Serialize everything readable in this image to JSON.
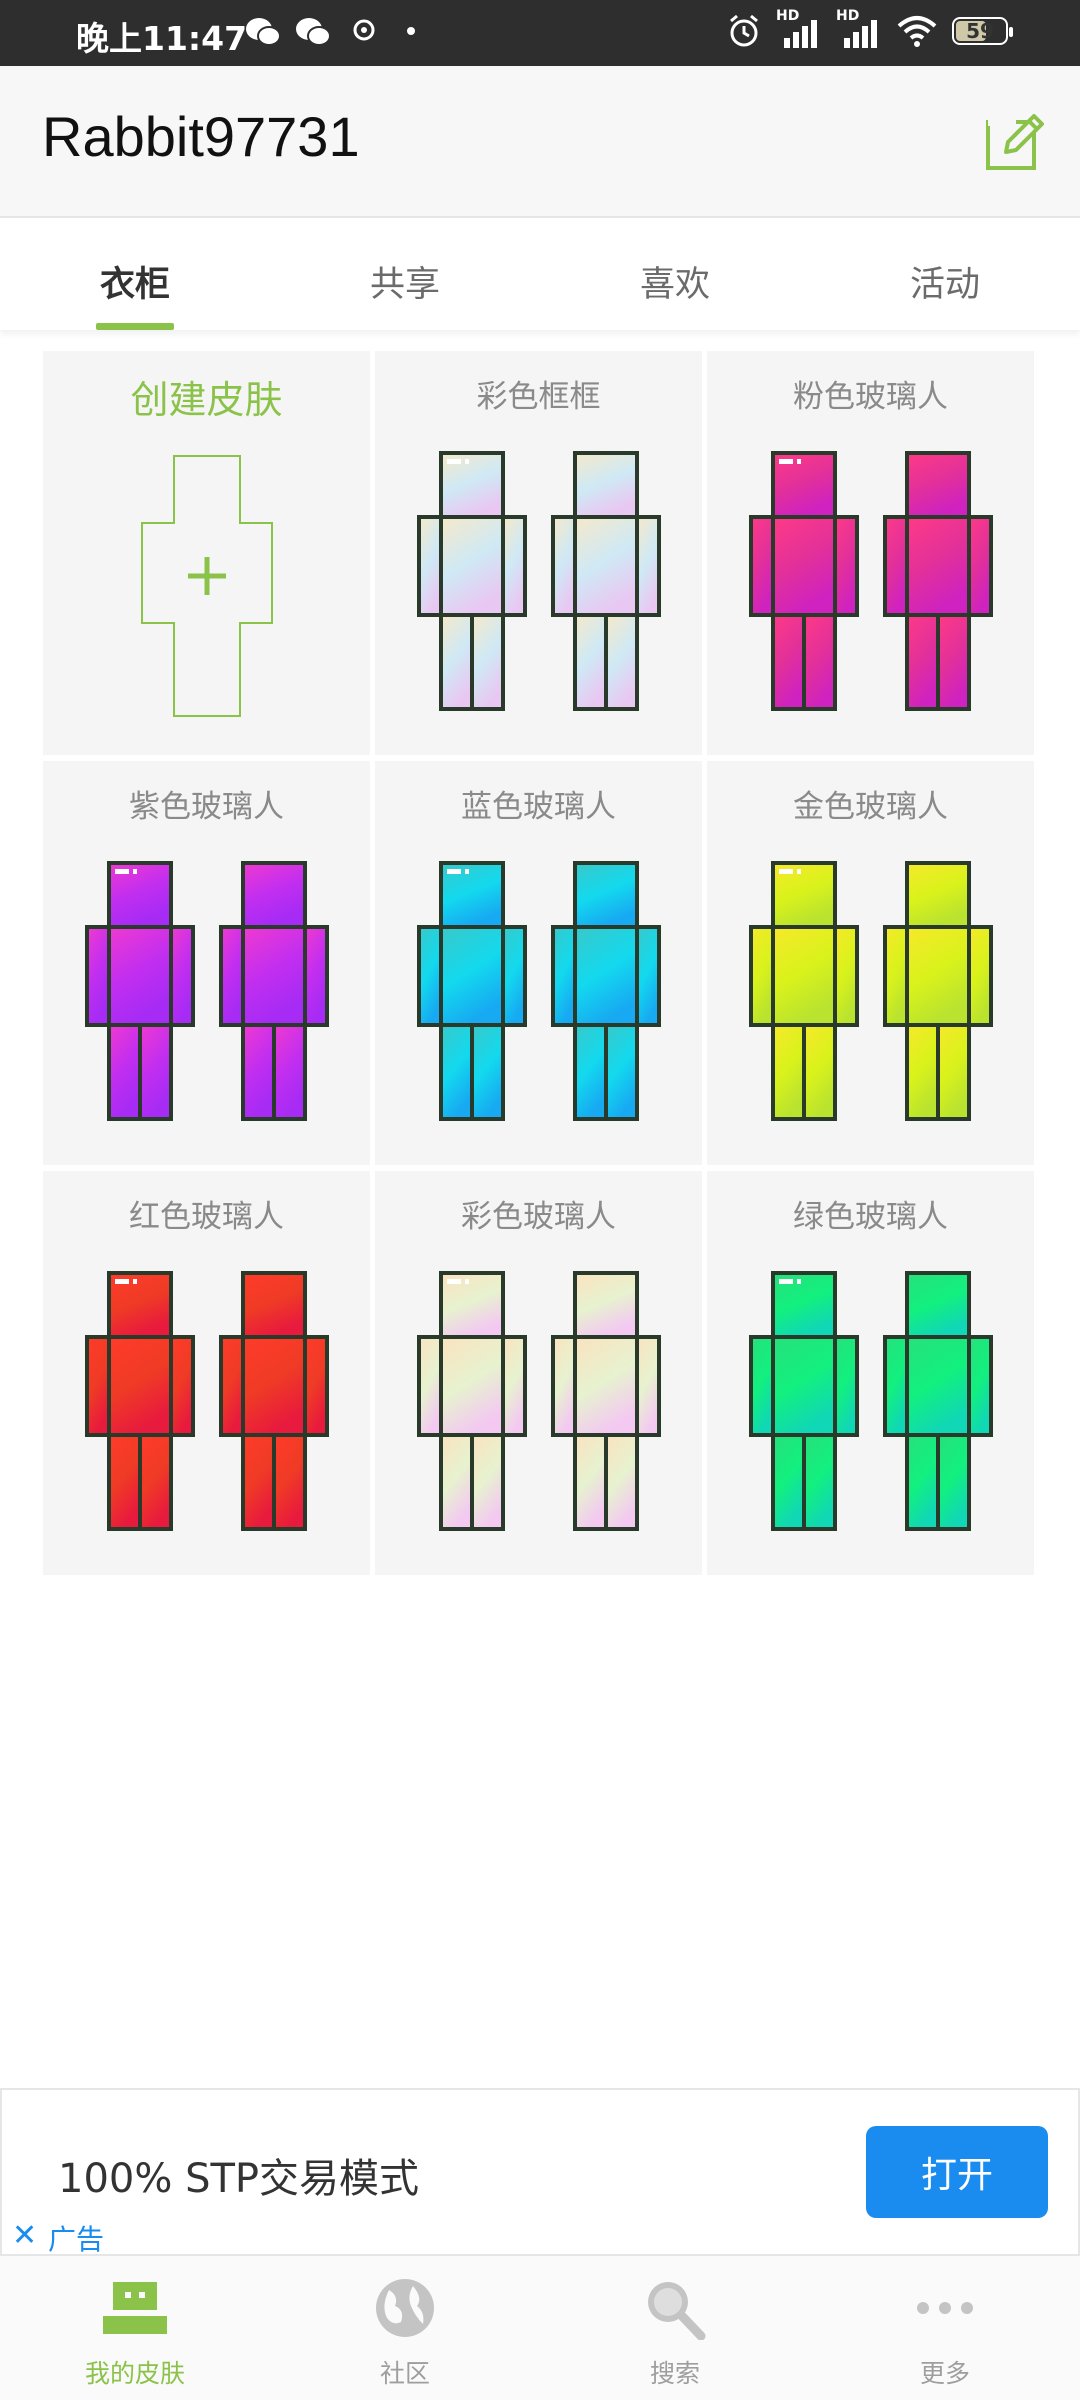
{
  "status_bar": {
    "time": "晚上11:47",
    "battery": "59",
    "network_labels": [
      "HD",
      "HD"
    ]
  },
  "header": {
    "title": "Rabbit97731",
    "edit_icon": "edit-icon"
  },
  "tabs": [
    {
      "label": "衣柜",
      "active": true
    },
    {
      "label": "共享",
      "active": false
    },
    {
      "label": "喜欢",
      "active": false
    },
    {
      "label": "活动",
      "active": false
    }
  ],
  "grid": {
    "create": {
      "label": "创建皮肤",
      "icon": "plus-icon"
    },
    "skins": [
      {
        "name": "彩色框框",
        "colors": [
          "#f6e9c9",
          "#cfe9f5",
          "#e8c8f2"
        ]
      },
      {
        "name": "粉色玻璃人",
        "colors": [
          "#ff3a86",
          "#e2309a",
          "#cf22c0"
        ]
      },
      {
        "name": "紫色玻璃人",
        "colors": [
          "#f03ad0",
          "#c12ef0",
          "#a52bf5"
        ]
      },
      {
        "name": "蓝色玻璃人",
        "colors": [
          "#39c8c8",
          "#13d9ee",
          "#17a9f2"
        ]
      },
      {
        "name": "金色玻璃人",
        "colors": [
          "#f7e92a",
          "#d9f21b",
          "#b9e32f"
        ]
      },
      {
        "name": "红色玻璃人",
        "colors": [
          "#ff3b2a",
          "#ef3b25",
          "#e81a3d"
        ]
      },
      {
        "name": "彩色玻璃人",
        "colors": [
          "#fbe2bf",
          "#e7f2cf",
          "#f3c9f1"
        ]
      },
      {
        "name": "绿色玻璃人",
        "colors": [
          "#27e07b",
          "#12f07e",
          "#10d7b5"
        ]
      }
    ]
  },
  "ad": {
    "text": "100% STP交易模式",
    "button_label": "打开",
    "close_glyph": "✕",
    "label": "广告"
  },
  "bottom_nav": [
    {
      "label": "我的皮肤",
      "icon": "skin-icon",
      "active": true
    },
    {
      "label": "社区",
      "icon": "globe-icon",
      "active": false
    },
    {
      "label": "搜索",
      "icon": "search-icon",
      "active": false
    },
    {
      "label": "更多",
      "icon": "more-icon",
      "active": false
    }
  ],
  "colors": {
    "accent": "#8bc34a",
    "ad_blue": "#1a8cf0",
    "status_bar": "#2e2e2e"
  }
}
